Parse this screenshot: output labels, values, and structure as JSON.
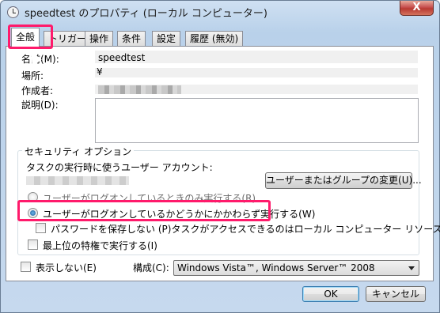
{
  "window": {
    "title": "speedtest のプロパティ (ローカル コンピューター)",
    "close_label": "X"
  },
  "tabs": [
    {
      "label": "全般"
    },
    {
      "label": "トリガー"
    },
    {
      "label": "操作"
    },
    {
      "label": "条件"
    },
    {
      "label": "設定"
    },
    {
      "label": "履歴 (無効)"
    }
  ],
  "general": {
    "name_label": "名前(M):",
    "name_value": "speedtest",
    "location_label": "場所:",
    "location_value": "¥",
    "author_label": "作成者:",
    "description_label": "説明(D):"
  },
  "security": {
    "group_title": "セキュリティ オプション",
    "account_prompt": "タスクの実行時に使うユーザー アカウント:",
    "change_user_button": "ユーザーまたはグループの変更(U)...",
    "radio_logged_on": "ユーザーがログオンしているときのみ実行する(R)",
    "radio_whether_logged_on": "ユーザーがログオンしているかどうかにかかわらず実行する(W)",
    "dont_store_password": "パスワードを保存しない (P)タスクがアクセスできるのはローカル コンピューター リソースのみ",
    "highest_privileges": "最上位の特権で実行する(I)"
  },
  "footer": {
    "hidden_label": "表示しない(E)",
    "configure_label": "構成(C):",
    "configure_value": "Windows Vista™, Windows Server™ 2008",
    "ok_button": "OK",
    "cancel_button": "キャンセル"
  },
  "colors": {
    "highlight": "#ff1a6b",
    "window_frame": "#b9d1ea"
  }
}
